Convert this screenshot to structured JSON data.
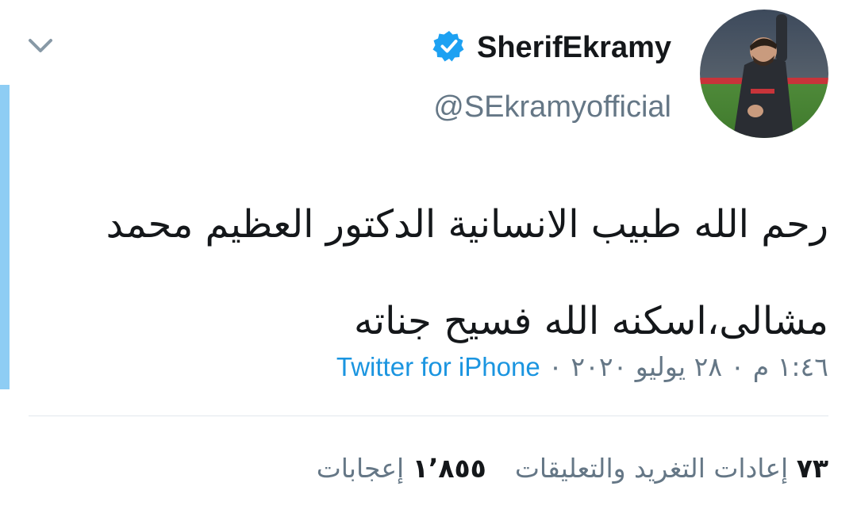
{
  "tweet": {
    "display_name": "SherifEkramy",
    "handle": "@SEkramyofficial",
    "verified": true,
    "avatar_icon": "profile-photo",
    "menu_icon": "chevron-down-icon",
    "text": "رحم الله طبيب الانسانية الدكتور العظيم محمد مشالى،اسكنه الله فسيح جناته",
    "timestamp": "١:٤٦ م ٠ ٢٨ يوليو ٢٠٢٠",
    "source_separator": " ٠ ",
    "source": "Twitter for iPhone"
  },
  "stats": {
    "retweets_count": "٧٣",
    "retweets_label": "إعادات التغريد والتعليقات",
    "likes_count": "١٬٨٥٥",
    "likes_label": "إعجابات"
  },
  "colors": {
    "accent_bar": "#8ecdf4",
    "link": "#1b95e0",
    "verified_badge": "#1da1f2",
    "secondary_text": "#657786",
    "primary_text": "#14171a",
    "divider": "#e1e8ed"
  }
}
